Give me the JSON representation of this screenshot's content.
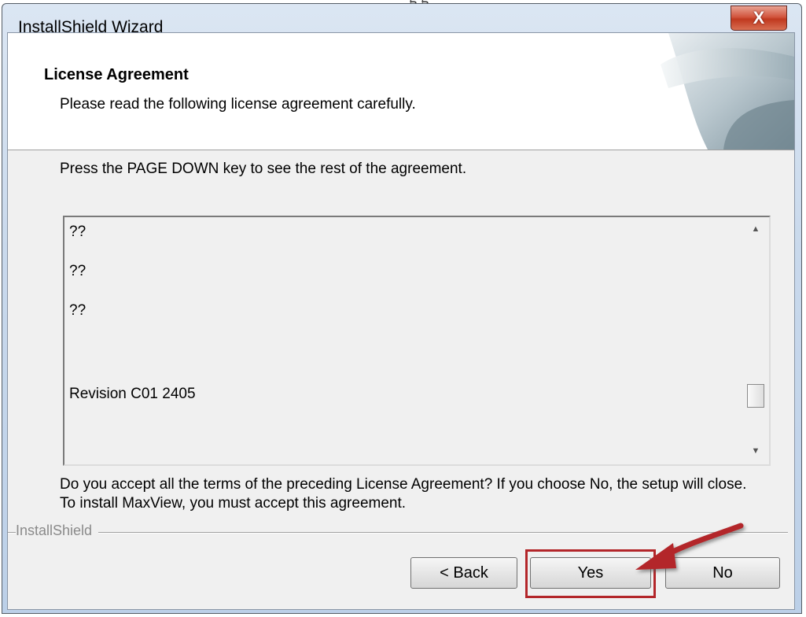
{
  "top_clip_text": "g g",
  "window": {
    "title": "InstallShield Wizard",
    "close_symbol": "X"
  },
  "header": {
    "title": "License Agreement",
    "subtitle": "Please read the following license agreement carefully."
  },
  "instruction": "Press the PAGE DOWN key to see the rest of the agreement.",
  "license": {
    "lines": [
      "??",
      "??",
      "??",
      "Revision C01 2405"
    ],
    "scroll_up_symbol": "▲",
    "scroll_down_symbol": "▼"
  },
  "question": "Do you accept all the terms of the preceding License Agreement?  If you choose No,  the setup will close.  To install MaxView, you must accept this agreement.",
  "brand": "InstallShield",
  "buttons": {
    "back": "< Back",
    "yes": "Yes",
    "no": "No"
  },
  "annotation": {
    "color": "#b3262a"
  }
}
